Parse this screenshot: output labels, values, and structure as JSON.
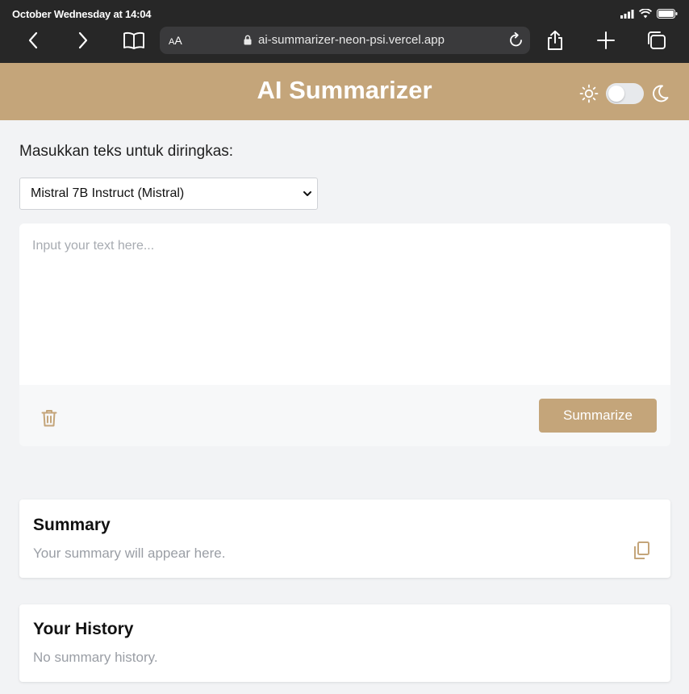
{
  "status_bar": {
    "time": "October Wednesday at 14:04"
  },
  "browser": {
    "text_size_label_small": "A",
    "text_size_label_large": "A",
    "url": "ai-summarizer-neon-psi.vercel.app",
    "icons": [
      "back-icon",
      "forward-icon",
      "bookmarks-icon",
      "lock-icon",
      "reload-icon",
      "share-icon",
      "new-tab-icon",
      "tabs-icon"
    ]
  },
  "header": {
    "title": "AI Summarizer",
    "theme_toggle": {
      "light_icon": "sun-icon",
      "dark_icon": "moon-icon",
      "state": "light"
    }
  },
  "form": {
    "prompt_label": "Masukkan teks untuk diringkas:",
    "model_select": {
      "selected": "Mistral 7B Instruct (Mistral)"
    },
    "text_input": {
      "value": "",
      "placeholder": "Input your text here..."
    },
    "clear_icon": "trash-icon",
    "summarize_label": "Summarize"
  },
  "summary": {
    "title": "Summary",
    "empty_text": "Your summary will appear here.",
    "copy_icon": "copy-icon"
  },
  "history": {
    "title": "Your History",
    "empty_text": "No summary history."
  },
  "colors": {
    "accent": "#c4a57a",
    "browser_chrome": "#272727",
    "background": "#f2f3f5"
  }
}
